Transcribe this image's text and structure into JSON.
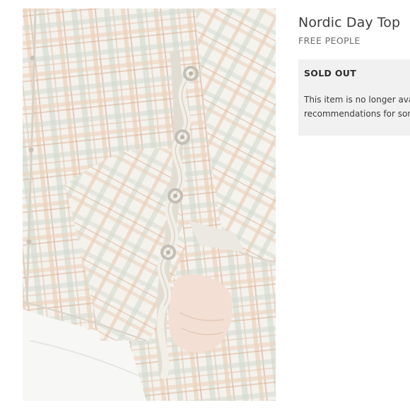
{
  "product": {
    "title": "Nordic Day Top",
    "brand": "FREE PEOPLE",
    "photo_alt": "Plaid lace-up side tunic"
  },
  "status": {
    "label": "SOLD OUT",
    "message_line1": "This item is no longer avail",
    "message_line2": "recommendations for som"
  },
  "colors": {
    "background": "#ffffff",
    "panel": "#f1f1f1",
    "plaid_base": "#f3f1ec",
    "plaid_peach": "#e8c3a6",
    "plaid_sage": "#bfc9b9"
  }
}
